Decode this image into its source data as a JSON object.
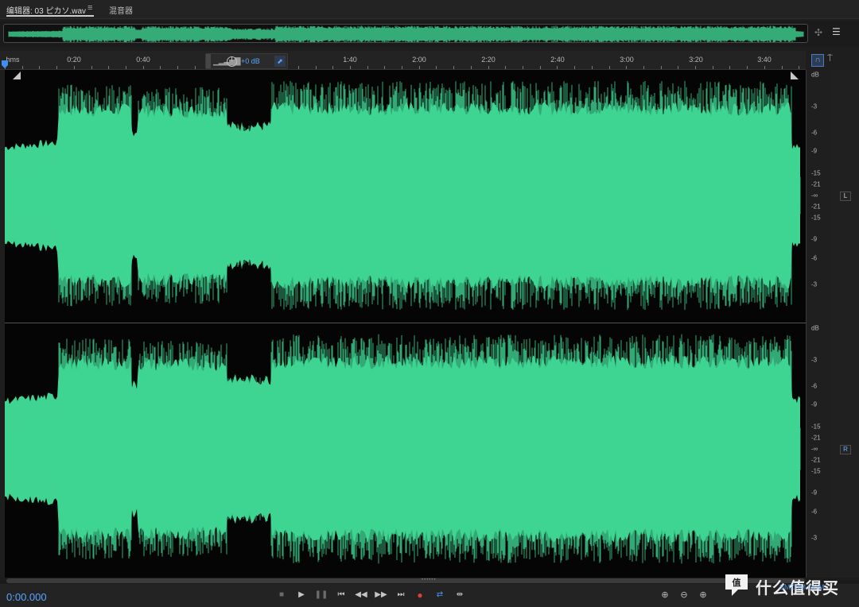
{
  "tabs": {
    "editor_label": "编辑器: 03 ピカソ.wav",
    "menu_glyph": "≡",
    "mixer_label": "混音器"
  },
  "ruler": {
    "unit_label": "hms",
    "time_labels": [
      "0:20",
      "0:40",
      "1:40",
      "2:00",
      "2:20",
      "2:40",
      "3:00",
      "3:20",
      "3:40"
    ]
  },
  "hud": {
    "volume": "+0 dB"
  },
  "db_scale": {
    "unit": "dB",
    "labels_top": [
      "-3",
      "-6",
      "-9",
      "-15",
      "-21",
      "-∞",
      "-21",
      "-15",
      "-9",
      "-6",
      "-3"
    ]
  },
  "channels": {
    "left": "L",
    "right": "R"
  },
  "transport": {
    "timecode": "0:00.000"
  },
  "colors": {
    "waveform": "#3fd492",
    "accent": "#58a6ff",
    "record": "#e13b3b"
  },
  "watermark": {
    "text": "什么值得买",
    "sub": "SMZDM.COM"
  }
}
